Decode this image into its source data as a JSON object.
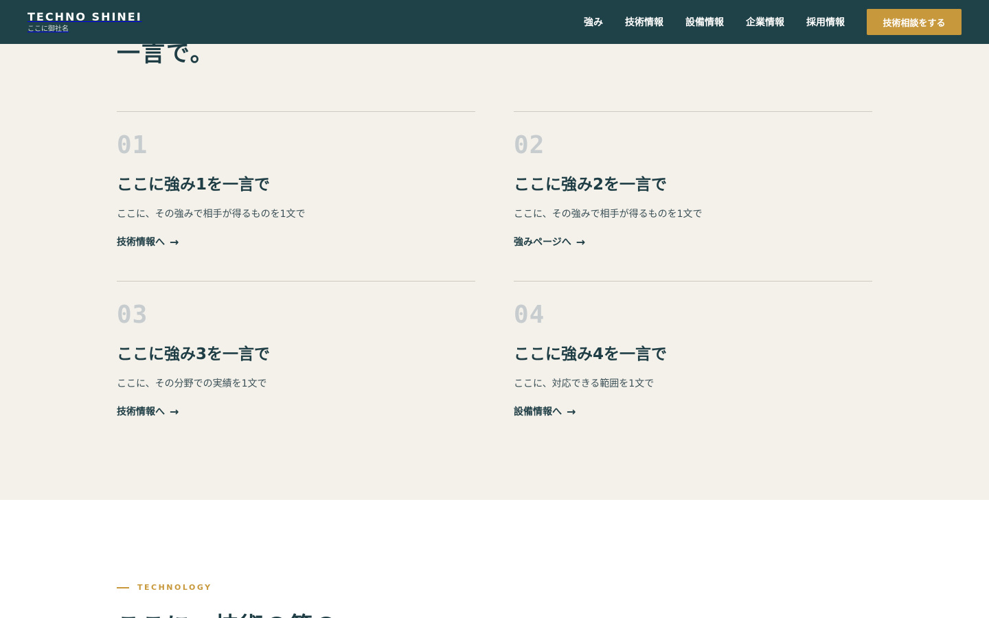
{
  "header": {
    "brand_name": "TECHNO SHINEI",
    "brand_sub": "ここに御社名",
    "nav": [
      "強み",
      "技術情報",
      "設備情報",
      "企業情報",
      "採用情報"
    ],
    "cta_label": "技術相談をする",
    "colors": {
      "header_bg": "#1f4148",
      "cta_bg": "#c8993c"
    }
  },
  "strengths": {
    "heading_tail": "一言で。",
    "items": [
      {
        "num": "01",
        "title": "ここに強み1を一言で",
        "desc": "ここに、その強みで相手が得るものを1文で",
        "link": "技術情報へ",
        "link_icon": "arrow-right-icon"
      },
      {
        "num": "02",
        "title": "ここに強み2を一言で",
        "desc": "ここに、その強みで相手が得るものを1文で",
        "link": "強みページへ",
        "link_icon": "arrow-right-icon"
      },
      {
        "num": "03",
        "title": "ここに強み3を一言で",
        "desc": "ここに、その分野での実績を1文で",
        "link": "技術情報へ",
        "link_icon": "arrow-right-icon"
      },
      {
        "num": "04",
        "title": "ここに強み4を一言で",
        "desc": "ここに、対応できる範囲を1文で",
        "link": "設備情報へ",
        "link_icon": "arrow-right-icon"
      }
    ],
    "arrow": "→"
  },
  "technology": {
    "label": "TECHNOLOGY",
    "heading": "ここに、技術の第の"
  }
}
